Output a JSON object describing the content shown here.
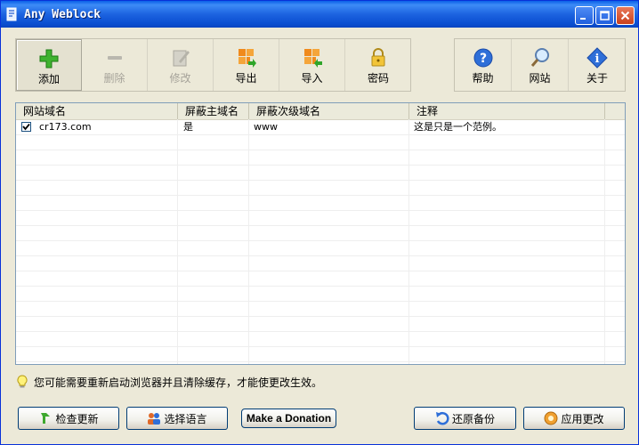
{
  "window": {
    "title": "Any Weblock"
  },
  "toolbar": {
    "add": "添加",
    "delete": "删除",
    "edit": "修改",
    "export": "导出",
    "import": "导入",
    "password": "密码",
    "help": "帮助",
    "website": "网站",
    "about": "关于"
  },
  "table": {
    "columns": [
      "网站域名",
      "屏蔽主域名",
      "屏蔽次级域名",
      "注释"
    ],
    "rows": [
      {
        "checked": true,
        "domain": "cr173.com",
        "block_main": "是",
        "block_sub": "www",
        "note": "这是只是一个范例。"
      }
    ]
  },
  "notice": {
    "text": "您可能需要重新启动浏览器并且清除缓存，才能使更改生效。"
  },
  "buttons": {
    "check_update": "检查更新",
    "select_language": "选择语言",
    "donation": "Make a Donation",
    "restore_backup": "还原备份",
    "apply_changes": "应用更改"
  },
  "colors": {
    "titlebar": "#0a5fe8",
    "window_bg": "#ece9d8",
    "border": "#7f9db9"
  }
}
